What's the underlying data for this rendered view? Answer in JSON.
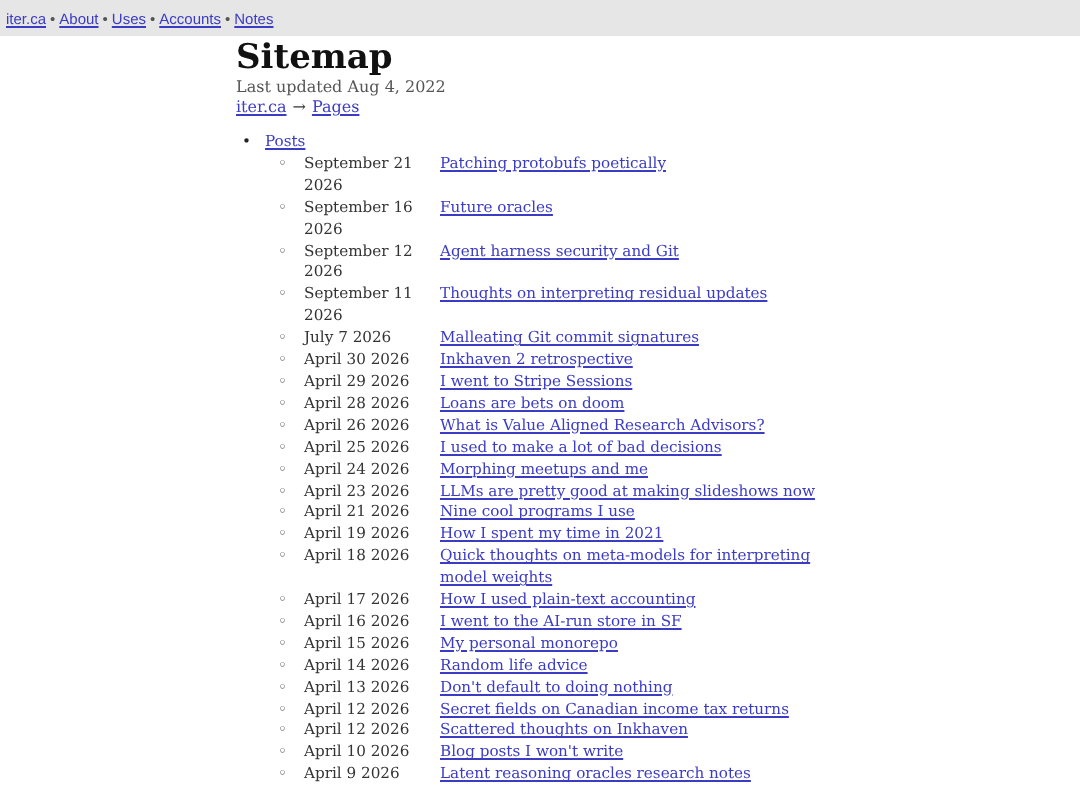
{
  "nav": [
    {
      "label": "iter.ca"
    },
    {
      "label": "About"
    },
    {
      "label": "Uses"
    },
    {
      "label": "Accounts"
    },
    {
      "label": "Notes"
    }
  ],
  "nav_separator": "•",
  "title": "Sitemap",
  "updated": "Last updated Aug 4, 2022",
  "breadcrumb": {
    "items": [
      {
        "label": "iter.ca"
      },
      {
        "label": "Pages"
      }
    ],
    "separator": "→"
  },
  "list_markers": {
    "outer": "•",
    "inner": "◦"
  },
  "sections": [
    {
      "label": "Posts",
      "posts": [
        {
          "date": "September 21 2026",
          "title": "Patching protobufs poetically"
        },
        {
          "date": "September 16 2026",
          "title": "Future oracles"
        },
        {
          "date": "September 12 2026",
          "title": "Agent harness security and Git"
        },
        {
          "date": "September 11 2026",
          "title": "Thoughts on interpreting residual updates"
        },
        {
          "date": "July 7 2026",
          "title": "Malleating Git commit signatures"
        },
        {
          "date": "April 30 2026",
          "title": "Inkhaven 2 retrospective"
        },
        {
          "date": "April 29 2026",
          "title": "I went to Stripe Sessions"
        },
        {
          "date": "April 28 2026",
          "title": "Loans are bets on doom"
        },
        {
          "date": "April 26 2026",
          "title": "What is Value Aligned Research Advisors?"
        },
        {
          "date": "April 25 2026",
          "title": "I used to make a lot of bad decisions"
        },
        {
          "date": "April 24 2026",
          "title": "Morphing meetups and me"
        },
        {
          "date": "April 23 2026",
          "title": "LLMs are pretty good at making slideshows now"
        },
        {
          "date": "April 21 2026",
          "title": "Nine cool programs I use"
        },
        {
          "date": "April 19 2026",
          "title": "How I spent my time in 2021"
        },
        {
          "date": "April 18 2026",
          "title": "Quick thoughts on meta-models for interpreting model weights"
        },
        {
          "date": "April 17 2026",
          "title": "How I used plain-text accounting"
        },
        {
          "date": "April 16 2026",
          "title": "I went to the AI-run store in SF"
        },
        {
          "date": "April 15 2026",
          "title": "My personal monorepo"
        },
        {
          "date": "April 14 2026",
          "title": "Random life advice"
        },
        {
          "date": "April 13 2026",
          "title": "Don't default to doing nothing"
        },
        {
          "date": "April 12 2026",
          "title": "Secret fields on Canadian income tax returns"
        },
        {
          "date": "April 12 2026",
          "title": "Scattered thoughts on Inkhaven"
        },
        {
          "date": "April 10 2026",
          "title": "Blog posts I won't write"
        },
        {
          "date": "April 9 2026",
          "title": "Latent reasoning oracles research notes"
        }
      ]
    }
  ]
}
